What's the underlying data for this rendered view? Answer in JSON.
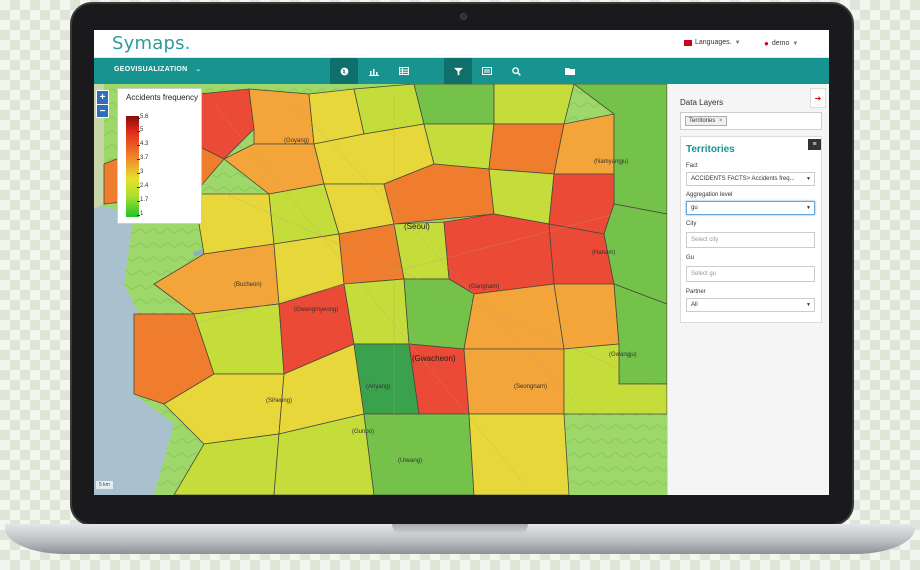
{
  "header": {
    "logo": "Symaps.",
    "languages_label": "Languages.",
    "user_label": "demo"
  },
  "nav": {
    "title": "GEOVISUALIZATION",
    "buttons": [
      {
        "icon": "globe-icon"
      },
      {
        "icon": "bar-chart-icon"
      },
      {
        "icon": "table-icon"
      },
      {
        "icon": "filter-icon"
      },
      {
        "icon": "list-icon"
      },
      {
        "icon": "search-icon"
      },
      {
        "icon": "folder-icon"
      }
    ]
  },
  "map": {
    "legend": {
      "title": "Accidents frequency",
      "ticks": [
        "5.6",
        "5",
        "4.3",
        "3.7",
        "3",
        "2.4",
        "1.7",
        "1"
      ]
    },
    "zoom_in": "+",
    "zoom_out": "−",
    "scale": "5 km",
    "labels": {
      "goyang": "(Goyang)",
      "seoul": "(Seoul)",
      "bucheon": "(Bucheon)",
      "gwangmyeong": "(Gwangmyeong)",
      "gwacheon": "(Gwacheon)",
      "anyang": "(Anyang)",
      "siheung": "(Siheung)",
      "gunpo": "(Gunpo)",
      "uiwang": "(Uiwang)",
      "hanam": "(Hanam)",
      "namyangju": "(Namyangju)",
      "gwangju": "(Gwangju)",
      "gangnam": "(Gangnam)",
      "seongnam": "(Seongnam)"
    },
    "colors": {
      "dark_red": "#c92d1f",
      "red": "#ea4a36",
      "orange": "#f07d2e",
      "light_orange": "#f4a53a",
      "yellow": "#e8d73a",
      "yellow_green": "#c4dd3a",
      "green": "#74c24a",
      "dark_green": "#3aa24c"
    }
  },
  "panel": {
    "title": "Data Layers",
    "layer_chip": "Territories",
    "territories_title": "Territories",
    "fact_label": "Fact",
    "fact_value": "ACCIDENTS FACTS> Accidents freq...",
    "aggregation_label": "Aggregation level",
    "aggregation_value": "gu",
    "city_label": "City",
    "city_placeholder": "Select city",
    "gu_label": "Gu",
    "gu_placeholder": "Select gu",
    "partner_label": "Partner",
    "partner_value": "All"
  }
}
